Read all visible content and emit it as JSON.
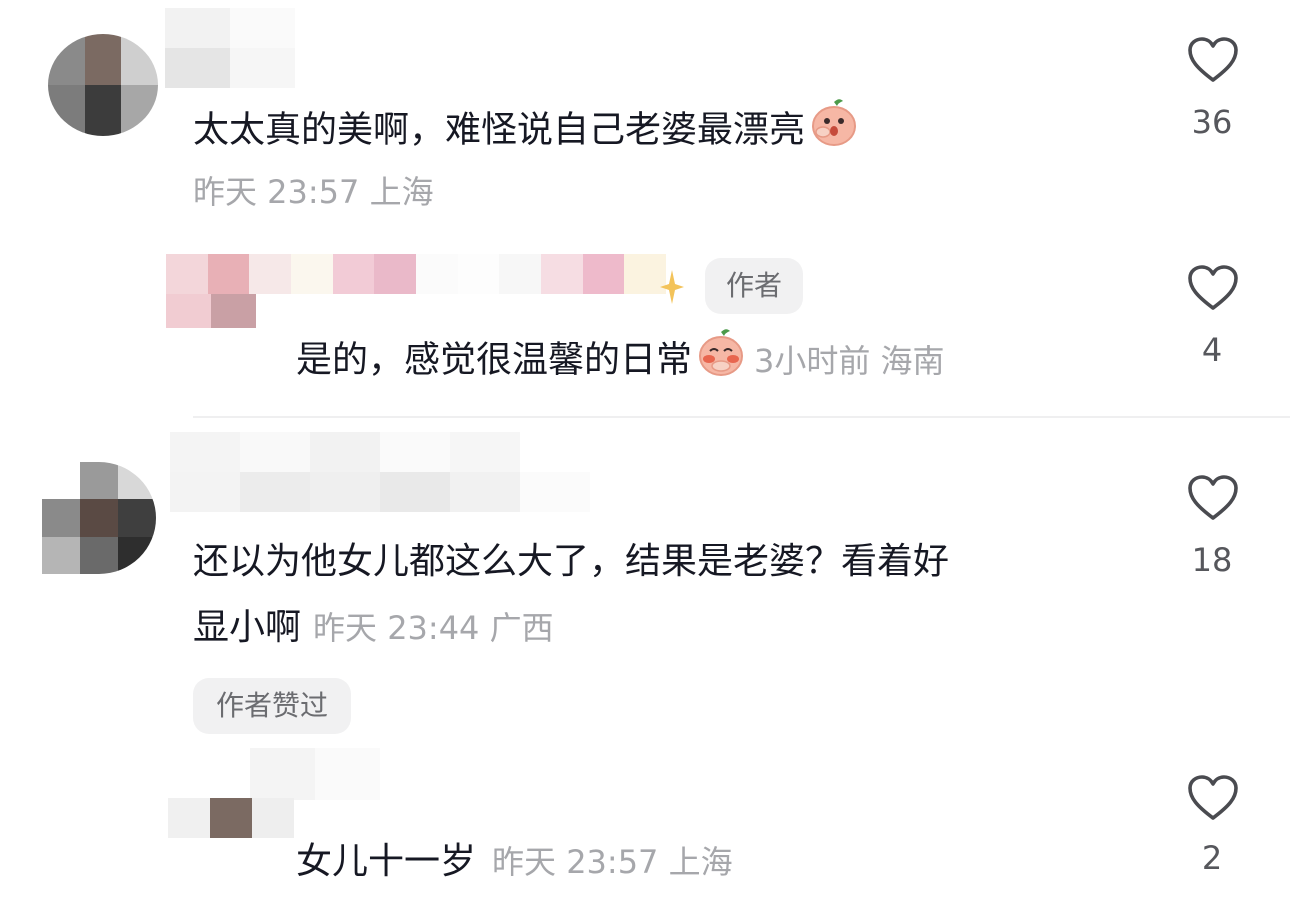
{
  "comments": [
    {
      "text": "太太真的美啊，难怪说自己老婆最漂亮",
      "time": "昨天 23:57 上海",
      "likes": "36",
      "emoji": "peach-covering-mouth"
    },
    {
      "author_badge": "作者",
      "text": "是的，感觉很温馨的日常",
      "time": "3小时前 海南",
      "likes": "4",
      "emoji": "peach-blushing"
    },
    {
      "text_line1": "还以为他女儿都这么大了，结果是老婆？看着好",
      "text_line2": "显小啊",
      "time": "昨天 23:44 广西",
      "likes": "18",
      "author_liked_badge": "作者赞过"
    },
    {
      "text": "女儿十一岁",
      "time": "昨天 23:57 上海",
      "likes": "2"
    }
  ],
  "colors": {
    "text": "#161823",
    "meta": "#a6a7ab",
    "badge_bg": "#f1f1f2",
    "divider": "#efeff0"
  }
}
